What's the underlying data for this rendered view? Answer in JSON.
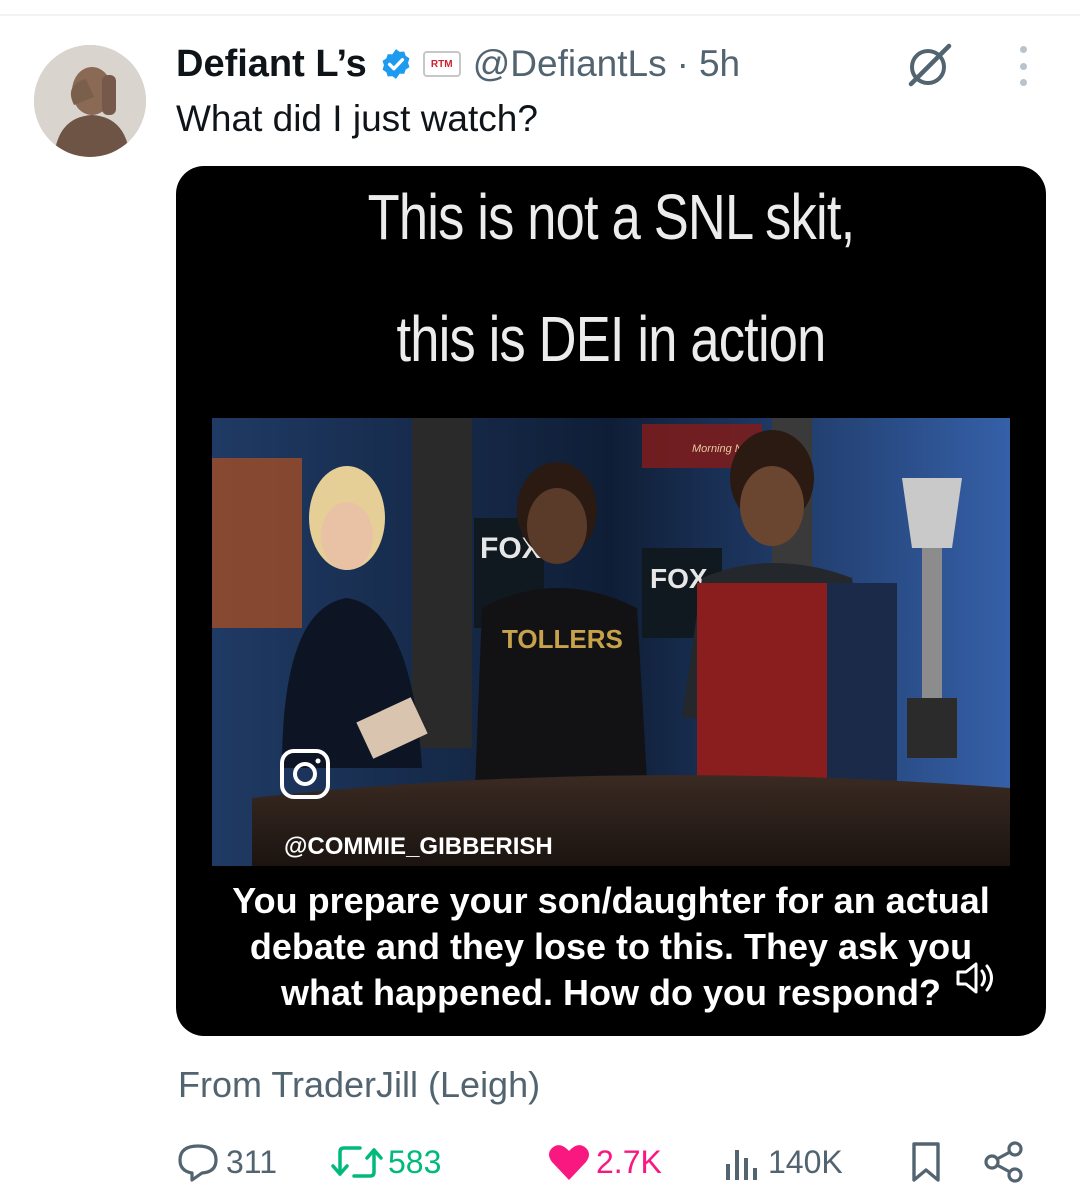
{
  "tweet": {
    "author_name": "Defiant L’s",
    "affiliate_badge": "RTM",
    "handle": "@DefiantLs",
    "separator": "·",
    "time": "5h",
    "text": "What did I just watch?",
    "media": {
      "headline_line1": "This is not a SNL skit,",
      "headline_line2": "this is DEI in action",
      "overlay_fox_1": "FOX",
      "overlay_fox_2": "FOX",
      "overlay_news": "Morning News",
      "overlay_shirt": "TOLLERS",
      "overlay_handle": "@COMMIE_GIBBERISH",
      "caption_line1": "You prepare your son/daughter for an actual",
      "caption_line2": "debate and they lose to this. They ask you",
      "caption_line3": "what happened. How do you respond?"
    },
    "source": "From TraderJill (Leigh)"
  },
  "actions": {
    "replies": "311",
    "reposts": "583",
    "likes": "2.7K",
    "views": "140K"
  },
  "icons": {
    "verified": "verified-badge-icon",
    "grok": "grok-icon",
    "more": "more-icon",
    "reply": "reply-icon",
    "repost": "repost-icon",
    "like": "heart-icon",
    "views": "views-icon",
    "bookmark": "bookmark-icon",
    "share": "share-icon",
    "sound": "sound-icon",
    "instagram": "instagram-icon"
  },
  "colors": {
    "verified": "#1d9bf0",
    "repost_active": "#00ba7c",
    "like_active": "#f91880",
    "secondary_text": "#536471"
  }
}
